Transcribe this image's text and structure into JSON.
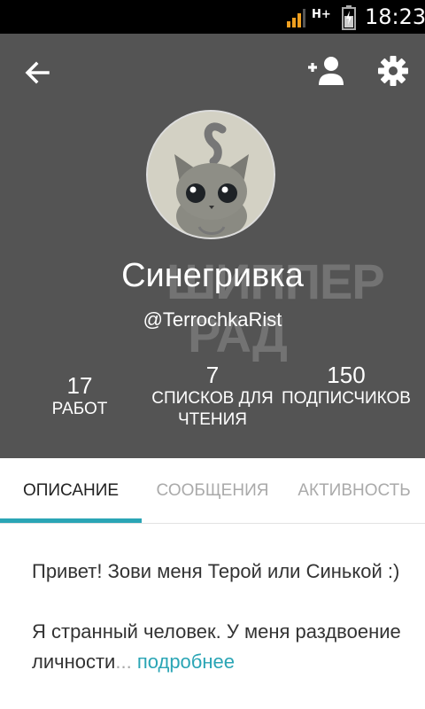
{
  "status_bar": {
    "time": "18:23",
    "network": "H+"
  },
  "header": {
    "display_name": "Синегривка",
    "handle": "@TerrochkaRist",
    "watermark_lines": [
      "ШИППЕР",
      "РАД"
    ],
    "stats": [
      {
        "value": "17",
        "label": "РАБОТ"
      },
      {
        "value": "7",
        "label": "СПИСКОВ ДЛЯ ЧТЕНИЯ"
      },
      {
        "value": "150",
        "label": "ПОДПИСЧИКОВ"
      }
    ]
  },
  "tabs": [
    {
      "label": "ОПИСАНИЕ",
      "active": true
    },
    {
      "label": "СООБЩЕНИЯ",
      "active": false
    },
    {
      "label": "АКТИВНОСТЬ",
      "active": false
    }
  ],
  "description": {
    "paragraph1": "Привет! Зови меня Терой или Синькой :)",
    "paragraph2": "Я странный человек. У меня раздвоение личности",
    "ellipsis": "...",
    "more_label": "подробнее"
  },
  "colors": {
    "header_bg": "#545454",
    "accent": "#2aa5b5"
  },
  "icons": [
    "back-arrow-icon",
    "add-user-icon",
    "gear-icon",
    "signal-icon",
    "battery-icon"
  ]
}
